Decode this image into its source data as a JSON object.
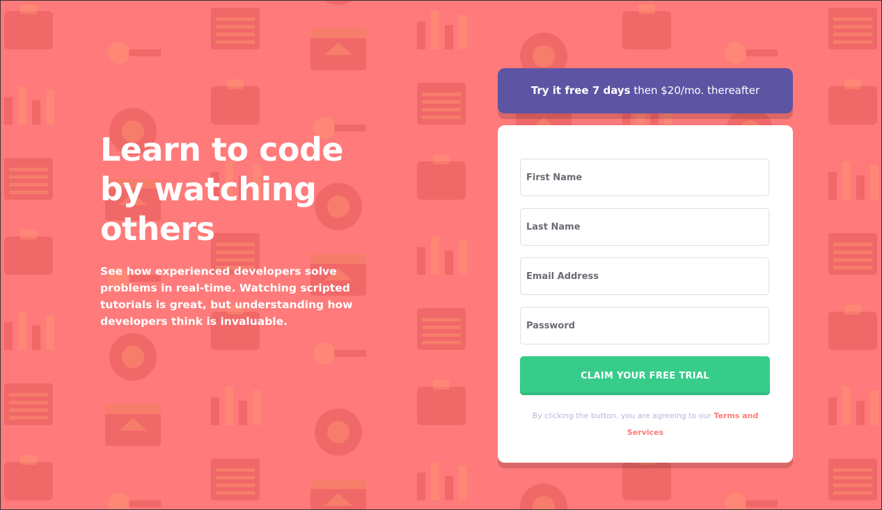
{
  "colors": {
    "background": "#ff7a7a",
    "promo": "#5e54a4",
    "button": "#38cc8b",
    "link": "#ff7a7a"
  },
  "hero": {
    "title_line1": "Learn to code",
    "title_line2": "by watching",
    "title_line3": "others",
    "description": "See how experienced developers solve problems in real-time. Watching scripted tutorials is great, but understanding how developers think is invaluable."
  },
  "promo": {
    "bold_text": "Try it free 7 days",
    "rest_text": " then $20/mo. thereafter"
  },
  "form": {
    "first_name_placeholder": "First Name",
    "last_name_placeholder": "Last Name",
    "email_placeholder": "Email Address",
    "password_placeholder": "Password",
    "submit_label": "CLAIM YOUR FREE TRIAL",
    "terms_prefix": "By clicking the button, you are agreeing to our ",
    "terms_link": "Terms and Services"
  },
  "background_icons": [
    "handcuff-icon",
    "bar-chart-icon",
    "browser-home-icon",
    "headset-icon",
    "toolbox-icon",
    "network-icon",
    "thumbs-up-icon",
    "gear-icon",
    "rocket-icon",
    "search-icon",
    "cart-icon",
    "key-icon",
    "globe-icon",
    "lifebuoy-icon",
    "calendar-icon"
  ]
}
